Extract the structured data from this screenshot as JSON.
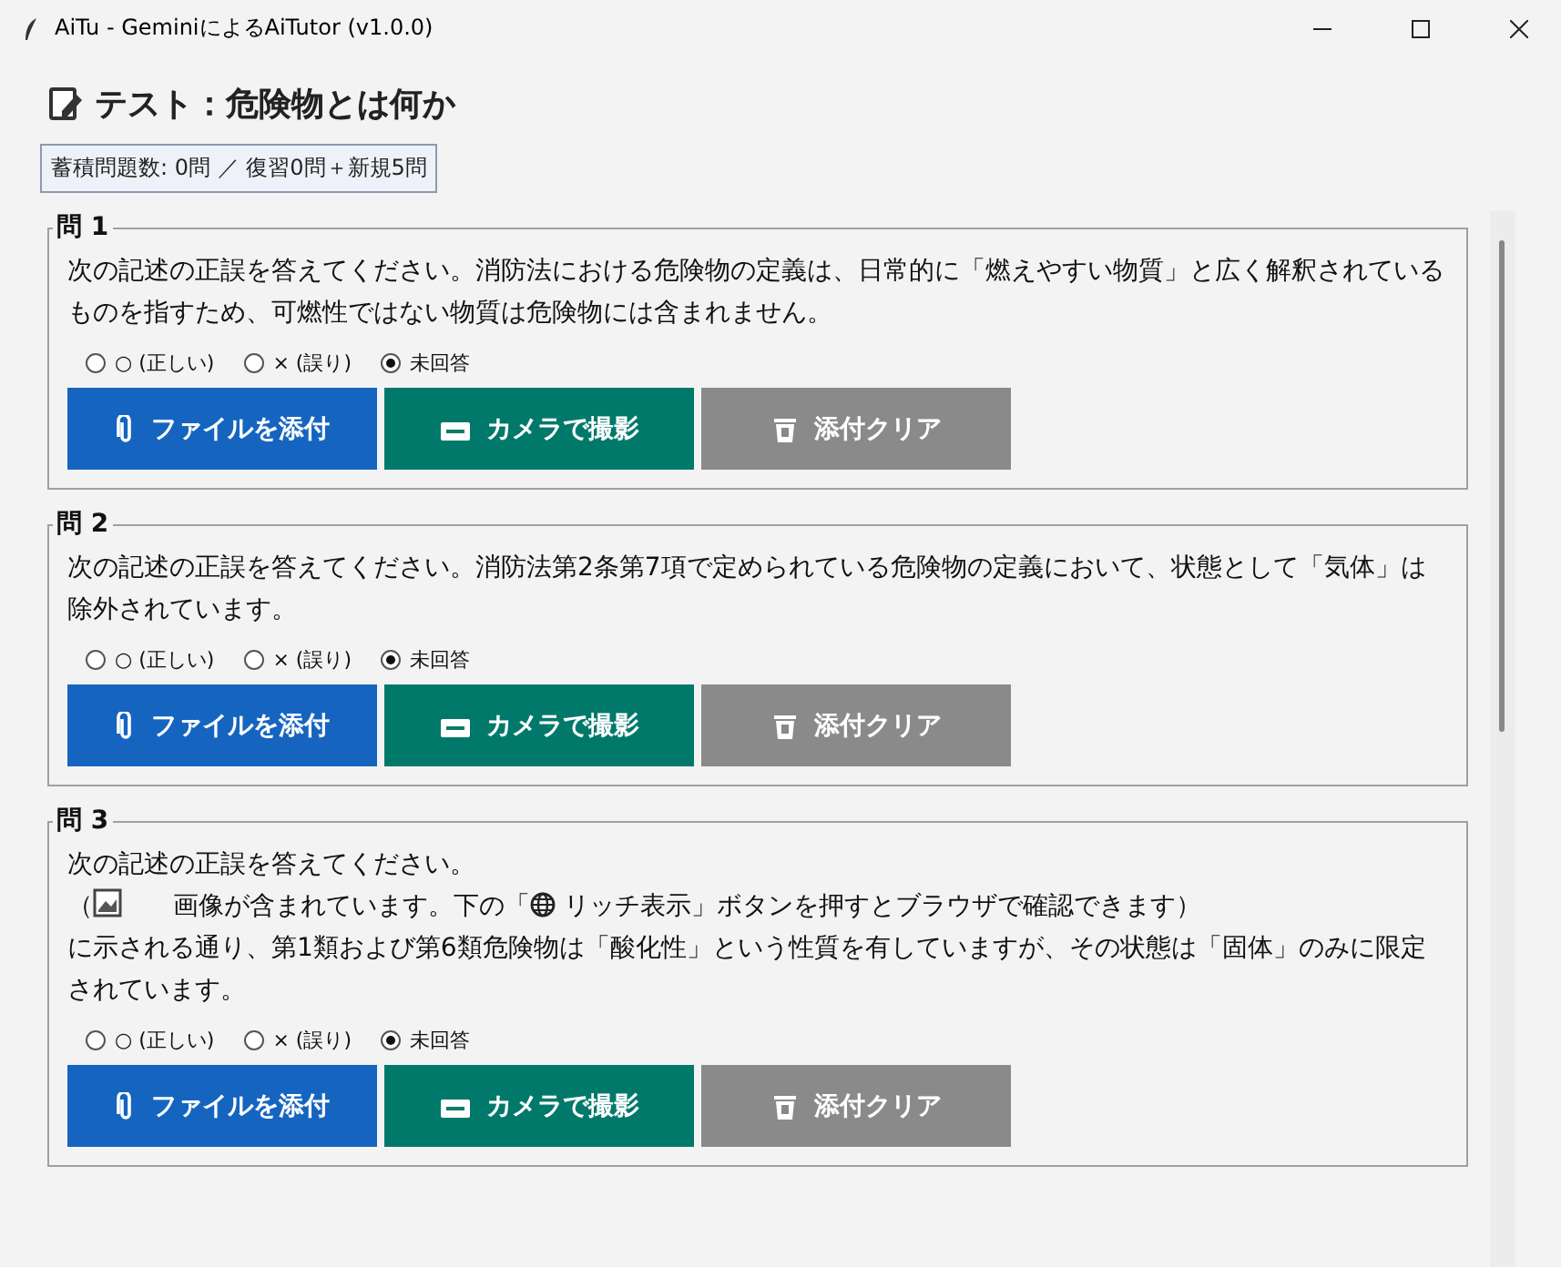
{
  "window": {
    "title": "AiTu - GeminiによるAiTutor (v1.0.0)"
  },
  "heading": "テスト：危険物とは何か",
  "stats": "蓄積問題数: 0問 ／ 復習0問＋新規5問",
  "questions": [
    {
      "label": "問 1",
      "paragraphs": [
        [
          {
            "kind": "text",
            "text": "次の記述の正誤を答えてください。消防法における危険物の定義は、日常的に「燃えやすい物質」と広く解釈されているものを指すため、可燃性ではない物質は危険物には含まれません。"
          }
        ]
      ],
      "options": [
        {
          "label": "○ (正しい)",
          "selected": false
        },
        {
          "label": "× (誤り)",
          "selected": false
        },
        {
          "label": "未回答",
          "selected": true
        }
      ],
      "buttons": [
        {
          "kind": "file",
          "label": "ファイルを添付"
        },
        {
          "kind": "camera",
          "label": "カメラで撮影"
        },
        {
          "kind": "clear",
          "label": "添付クリア"
        }
      ]
    },
    {
      "label": "問 2",
      "paragraphs": [
        [
          {
            "kind": "text",
            "text": "次の記述の正誤を答えてください。消防法第2条第7項で定められている危険物の定義において、状態として「気体」は除外されています。"
          }
        ]
      ],
      "options": [
        {
          "label": "○ (正しい)",
          "selected": false
        },
        {
          "label": "× (誤り)",
          "selected": false
        },
        {
          "label": "未回答",
          "selected": true
        }
      ],
      "buttons": [
        {
          "kind": "file",
          "label": "ファイルを添付"
        },
        {
          "kind": "camera",
          "label": "カメラで撮影"
        },
        {
          "kind": "clear",
          "label": "添付クリア"
        }
      ]
    },
    {
      "label": "問 3",
      "paragraphs": [
        [
          {
            "kind": "text",
            "text": "次の記述の正誤を答えてください。"
          }
        ],
        [
          {
            "kind": "text",
            "text": "（"
          },
          {
            "kind": "picture"
          },
          {
            "kind": "text",
            "text": "　　画像が含まれています。下の「"
          },
          {
            "kind": "globe"
          },
          {
            "kind": "text",
            "text": " リッチ表示」ボタンを押すとブラウザで確認できます）"
          }
        ],
        [
          {
            "kind": "text",
            "text": "に示される通り、第1類および第6類危険物は「酸化性」という性質を有していますが、その状態は「固体」のみに限定されています。"
          }
        ]
      ],
      "options": [
        {
          "label": "○ (正しい)",
          "selected": false
        },
        {
          "label": "× (誤り)",
          "selected": false
        },
        {
          "label": "未回答",
          "selected": true
        }
      ],
      "buttons": [
        {
          "kind": "file",
          "label": "ファイルを添付"
        },
        {
          "kind": "camera",
          "label": "カメラで撮影"
        },
        {
          "kind": "clear",
          "label": "添付クリア"
        }
      ]
    }
  ]
}
